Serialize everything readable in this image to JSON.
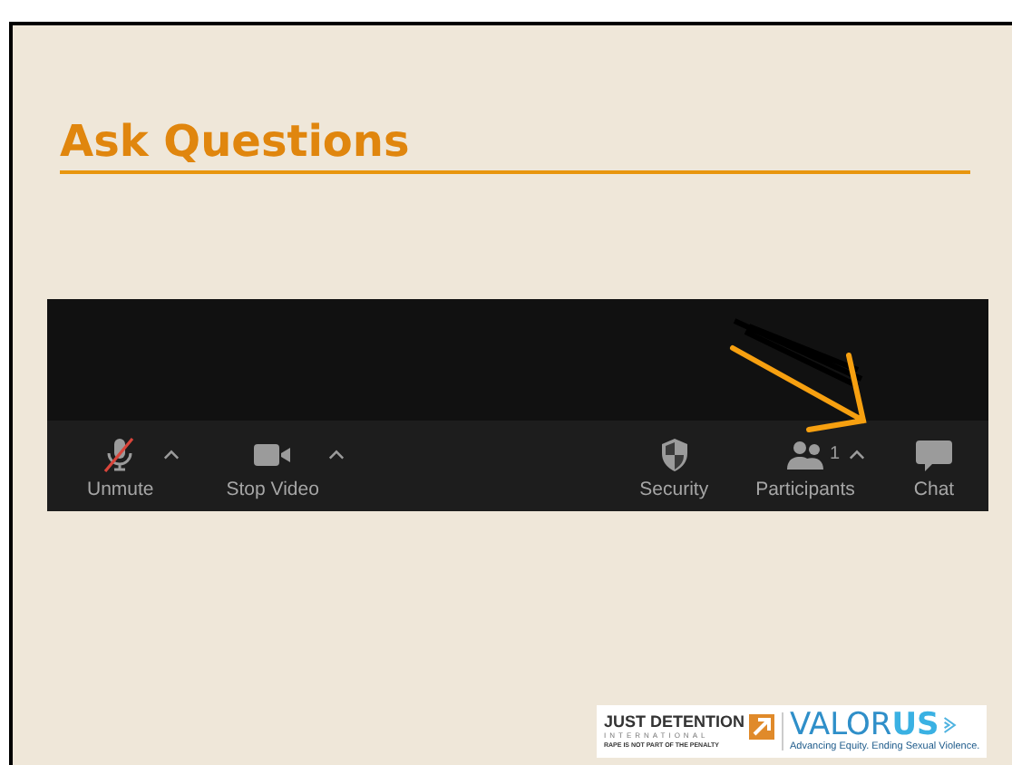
{
  "slide": {
    "title": "Ask Questions"
  },
  "toolbar": {
    "items": [
      {
        "kind": "mic",
        "label": "Unmute",
        "muted": true,
        "caret": true
      },
      {
        "kind": "video",
        "label": "Stop Video",
        "caret": true
      },
      {
        "kind": "spacer"
      },
      {
        "kind": "shield",
        "label": "Security",
        "caret": false
      },
      {
        "kind": "people",
        "label": "Participants",
        "count": "1",
        "caret": true
      },
      {
        "kind": "chat",
        "label": "Chat",
        "caret": false
      }
    ]
  },
  "logos": {
    "jdi": {
      "name": "JUST DETENTION",
      "sub": "INTERNATIONAL",
      "tagline": "RAPE IS NOT PART OF THE PENALTY"
    },
    "valorus": {
      "name_a": "VALOR",
      "name_b": "US",
      "tagline": "Advancing Equity. Ending Sexual Violence."
    }
  }
}
